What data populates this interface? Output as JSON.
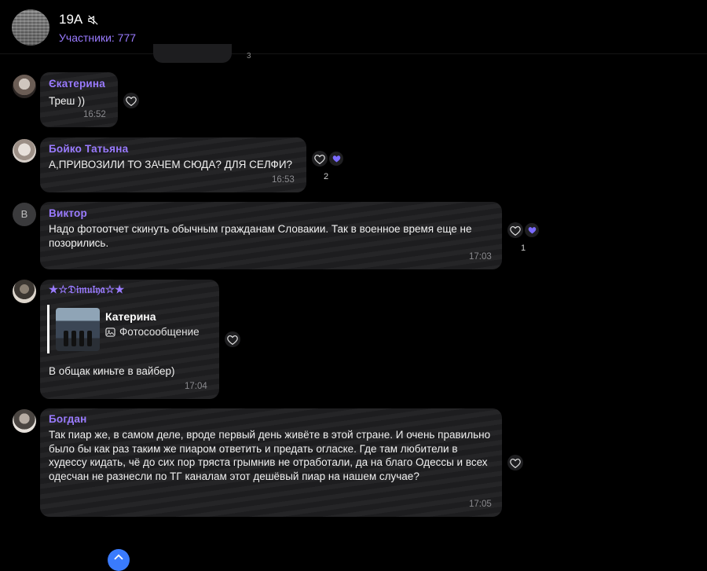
{
  "header": {
    "title": "19A",
    "subtitle": "Участники: 777",
    "mute_icon": "speaker-muted-icon"
  },
  "prev_partial": {
    "count": "3"
  },
  "messages": [
    {
      "sender": "Єкатерина",
      "text": "Треш ))",
      "time": "16:52",
      "reactions": null
    },
    {
      "sender": "Бойко Татьяна",
      "text": "А,ПРИВОЗИЛИ ТО ЗАЧЕМ СЮДА? ДЛЯ СЕЛФИ?",
      "time": "16:53",
      "reaction_count": "2"
    },
    {
      "sender": "Виктор",
      "avatar_letter": "В",
      "text": "Надо фотоотчет скинуть обычным гражданам Словакии. Так в военное время еще не позорились.",
      "time": "17:03",
      "reaction_count": "1"
    },
    {
      "sender": "★☆𝔇𝔦𝔪𝔲𝔩𝔶𝔞☆★",
      "reply": {
        "name": "Катерина",
        "type": "Фотосообщение"
      },
      "text": "В общак киньте в вайбер)",
      "time": "17:04"
    },
    {
      "sender": "Богдан",
      "text": "Так пиар же, в самом деле, вроде первый день живёте в этой стране. И очень правильно было бы как раз таким же пиаром ответить и предать огласке. Где там любители в худессу кидать, чё до сих пор тряста грымнив не отработали, да на благо Одессы и всех одесчан не разнесли по ТГ каналам этот дешёвый пиар на нашем случае?",
      "time": "17:05"
    }
  ],
  "colors": {
    "accent": "#9a7bff",
    "bubble": "#1d1d1f",
    "background": "#000000",
    "scroll_button": "#3a7bfd"
  }
}
